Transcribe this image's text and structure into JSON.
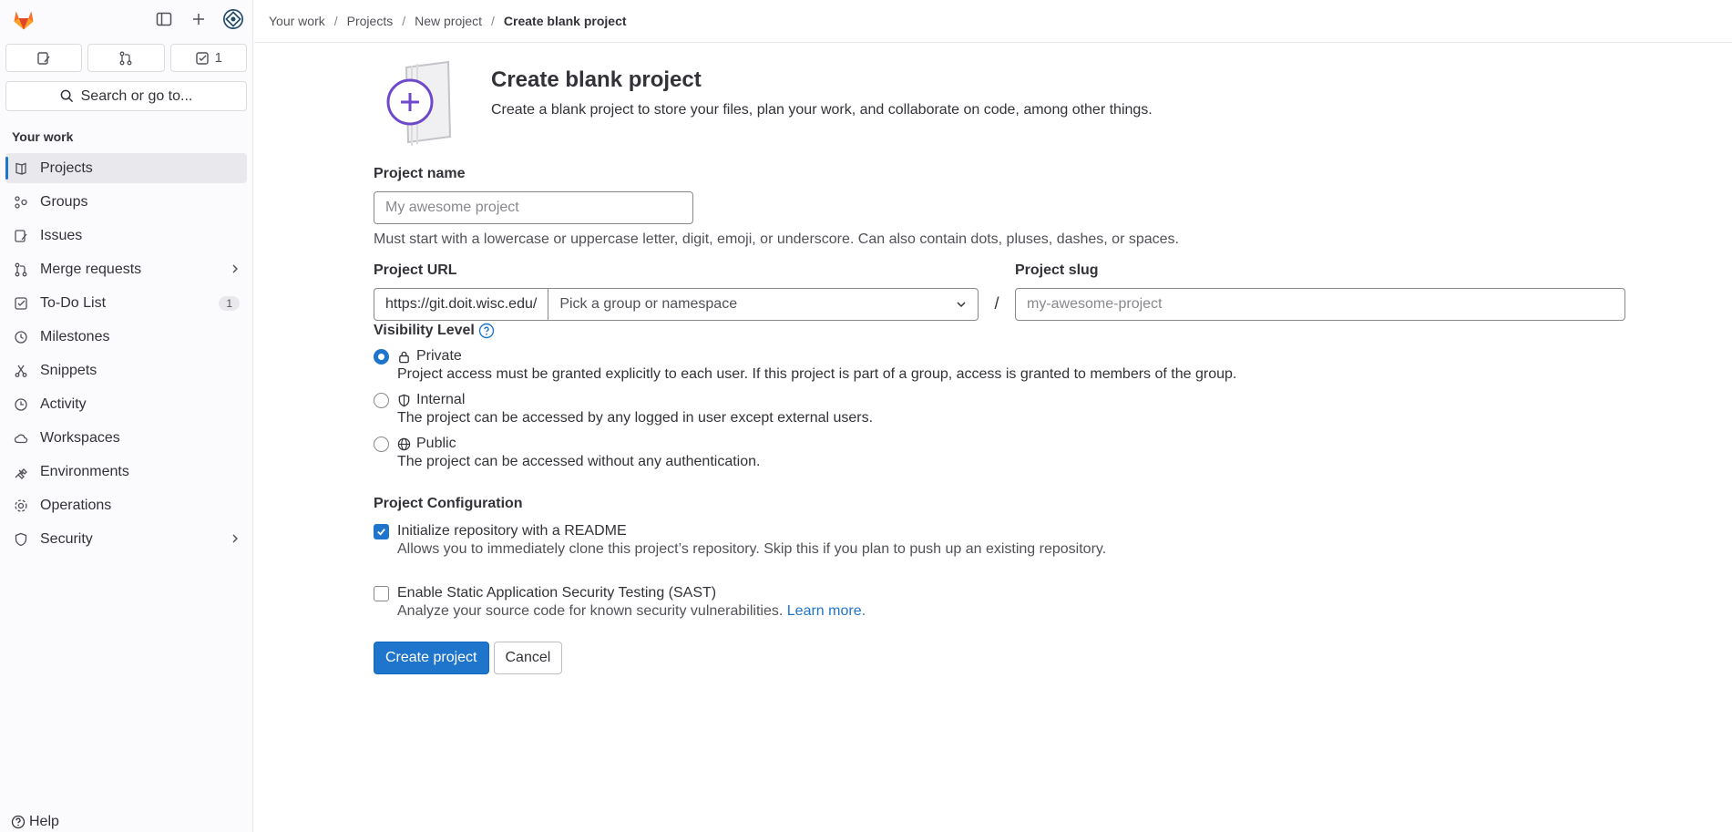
{
  "sidebar": {
    "counters": [
      {
        "icon": "issues-icon",
        "count": ""
      },
      {
        "icon": "merge-request-icon",
        "count": ""
      },
      {
        "icon": "todo-icon",
        "count": "1"
      }
    ],
    "search_label": "Search or go to...",
    "section_title": "Your work",
    "items": [
      {
        "label": "Projects",
        "icon": "project-icon"
      },
      {
        "label": "Groups",
        "icon": "group-icon"
      },
      {
        "label": "Issues",
        "icon": "issues-icon"
      },
      {
        "label": "Merge requests",
        "icon": "merge-request-icon"
      },
      {
        "label": "To-Do List",
        "icon": "todo-icon",
        "badge": "1"
      },
      {
        "label": "Milestones",
        "icon": "clock-icon"
      },
      {
        "label": "Snippets",
        "icon": "snippet-icon"
      },
      {
        "label": "Activity",
        "icon": "history-icon"
      },
      {
        "label": "Workspaces",
        "icon": "cloud-icon"
      },
      {
        "label": "Environments",
        "icon": "environment-icon"
      },
      {
        "label": "Operations",
        "icon": "deployments-icon"
      },
      {
        "label": "Security",
        "icon": "shield-icon"
      }
    ],
    "help_label": "Help"
  },
  "breadcrumb": [
    "Your work",
    "Projects",
    "New project",
    "Create blank project"
  ],
  "header": {
    "title": "Create blank project",
    "description": "Create a blank project to store your files, plan your work, and collaborate on code, among other things."
  },
  "form": {
    "name_label": "Project name",
    "name_placeholder": "My awesome project",
    "name_help": "Must start with a lowercase or uppercase letter, digit, emoji, or underscore. Can also contain dots, pluses, dashes, or spaces.",
    "url_label": "Project URL",
    "url_prefix": "https://git.doit.wisc.edu/",
    "namespace_placeholder": "Pick a group or namespace",
    "slash": "/",
    "slug_label": "Project slug",
    "slug_placeholder": "my-awesome-project",
    "visibility_title": "Visibility Level",
    "visibility": [
      {
        "label": "Private",
        "desc": "Project access must be granted explicitly to each user. If this project is part of a group, access is granted to members of the group.",
        "checked": true
      },
      {
        "label": "Internal",
        "desc": "The project can be accessed by any logged in user except external users.",
        "checked": false
      },
      {
        "label": "Public",
        "desc": "The project can be accessed without any authentication.",
        "checked": false
      }
    ],
    "config_title": "Project Configuration",
    "readme_label": "Initialize repository with a README",
    "readme_desc": "Allows you to immediately clone this project’s repository. Skip this if you plan to push up an existing repository.",
    "sast_label": "Enable Static Application Security Testing (SAST)",
    "sast_desc": "Analyze your source code for known security vulnerabilities.",
    "sast_link": "Learn more.",
    "create_button": "Create project",
    "cancel_button": "Cancel"
  },
  "colors": {
    "accent": "#1f75cb",
    "brand": "#fc6d26",
    "illustration": "#6e49cb"
  }
}
